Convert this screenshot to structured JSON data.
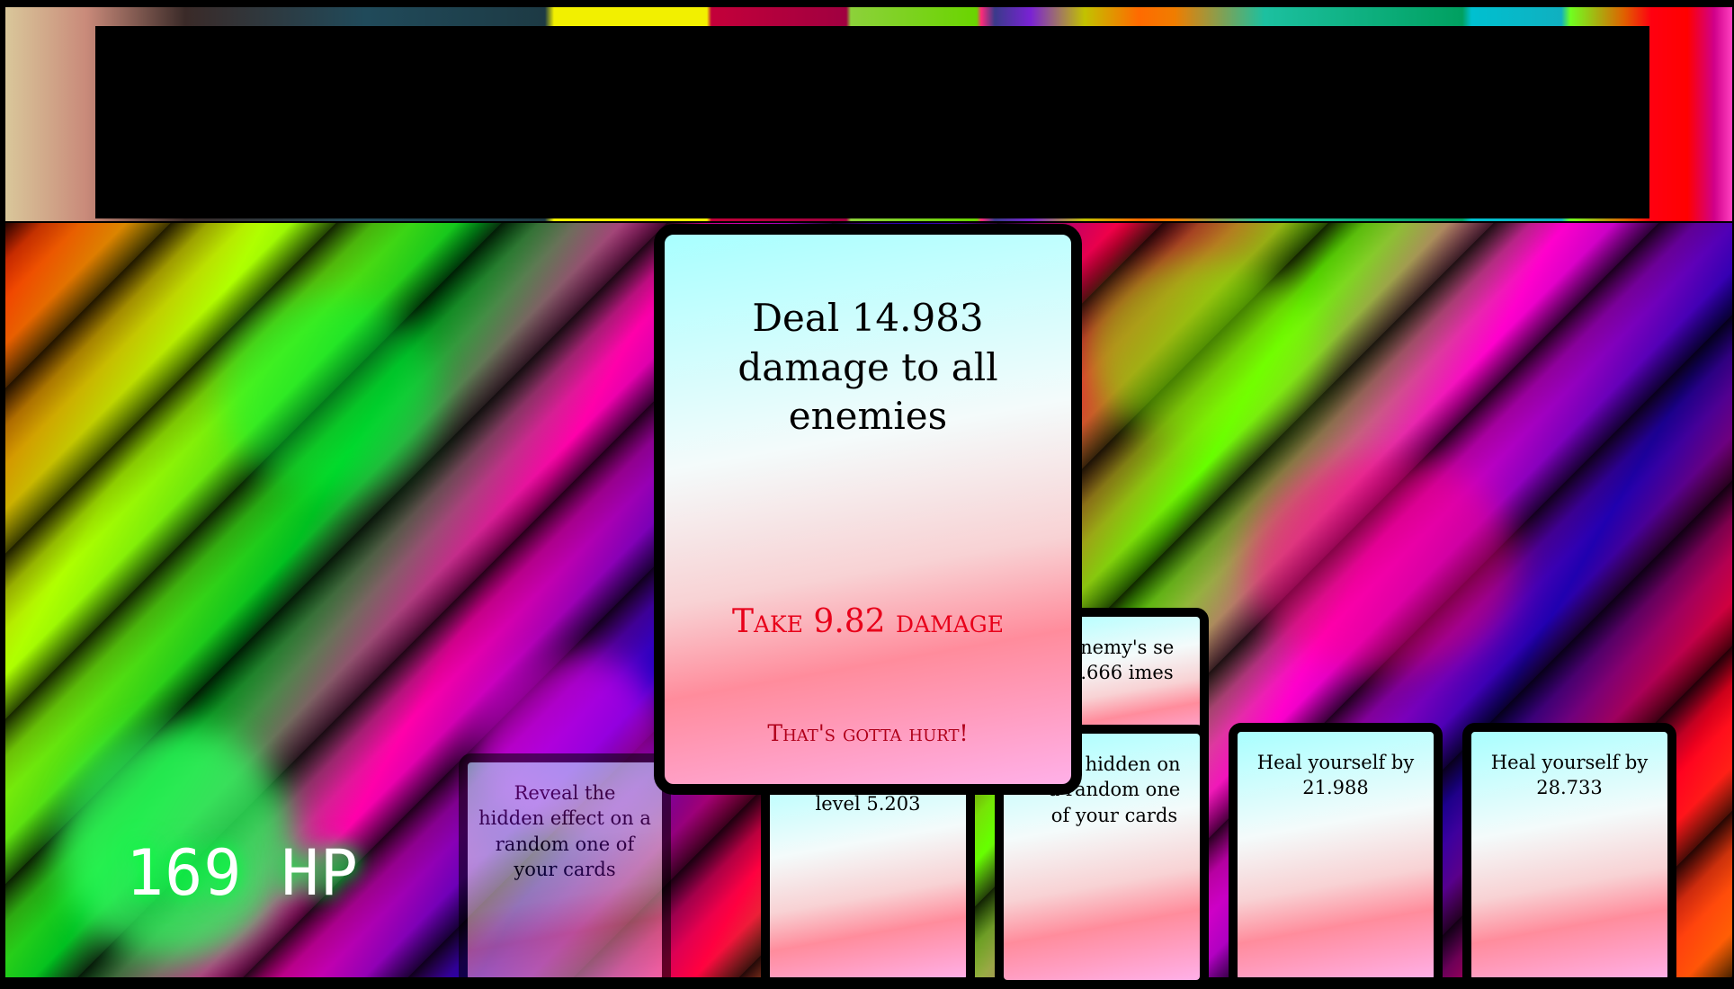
{
  "player": {
    "hp_label": "169 HP"
  },
  "selected_card": {
    "effect": "Deal 14.983 damage to all enemies",
    "penalty": "Take 9.82 damage",
    "flavor": "That's gotta hurt!"
  },
  "hand": [
    {
      "text": "Reveal the hidden effect on a random one of your cards"
    },
    {
      "text": "level 5.203"
    },
    {
      "text": "an enemy's se by 0.666 imes"
    },
    {
      "text": "the hidden on a random one of your cards"
    },
    {
      "text": "Heal yourself by 21.988"
    },
    {
      "text": "Heal yourself by 28.733"
    }
  ],
  "colors": {
    "card_border": "#000000",
    "penalty_text": "#e8001a",
    "hp_glow": "#00ff30"
  }
}
